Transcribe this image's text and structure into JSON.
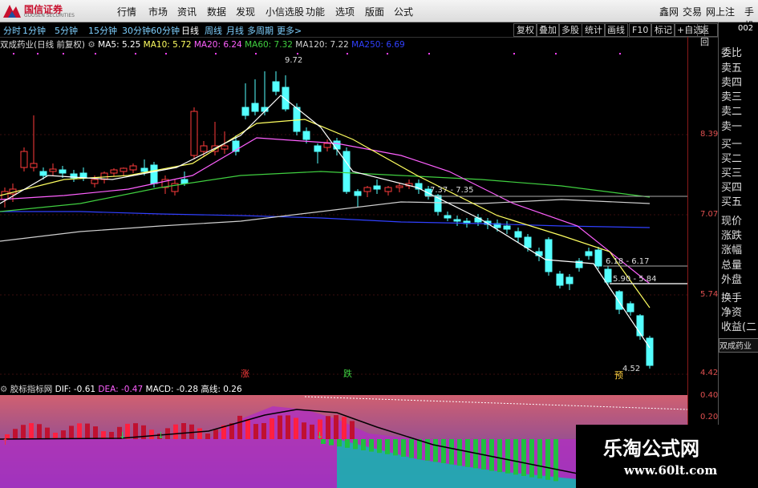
{
  "app": {
    "logo_text": "国信证券",
    "logo_sub": "GUOSEN SECURITIES"
  },
  "menu": {
    "items": [
      "行情",
      "市场",
      "资讯",
      "数据",
      "发现",
      "小信选股",
      "功能",
      "选项",
      "版面",
      "公式"
    ],
    "right_items": [
      "鑫网",
      "交易",
      "网上注",
      "手机"
    ]
  },
  "timeframes": [
    "分时",
    "1分钟",
    "5分钟",
    "15分钟",
    "30分钟",
    "60分钟",
    "日线",
    "周线",
    "月线",
    "多周期",
    "更多>"
  ],
  "active_timeframe": "日线",
  "right_buttons": [
    "复权",
    "叠加",
    "多股",
    "统计",
    "画线",
    "F10",
    "标记",
    "+自选",
    "返回"
  ],
  "ma_bar": {
    "stock": "双成药业(日线 前复权)",
    "ma5": "MA5: 5.25",
    "ma10": "MA10: 5.72",
    "ma20": "MA20: 6.24",
    "ma60": "MA60: 7.32",
    "ma120": "MA120: 7.22",
    "ma250": "MA250: 6.69"
  },
  "colors": {
    "up": "#ff3c3c",
    "down": "#54ffff",
    "ma5": "#ffffff",
    "ma10": "#ffff60",
    "ma20": "#ff60ff",
    "ma60": "#40d040",
    "ma120": "#d0d0d0",
    "ma250": "#3040ff"
  },
  "price_axis": [
    "8.39",
    "7.07",
    "5.74",
    "4.42"
  ],
  "annotations": {
    "high": "9.72",
    "low": "4.52",
    "zone1": "7.37 - 7.35",
    "zone2": "6.18 - 6.17",
    "zone3": "5.90 - 5.84",
    "marker_up": "涨",
    "marker_down": "跌",
    "marker_wave": "预"
  },
  "side_panel": {
    "top_label": "002",
    "items": [
      "委比",
      "卖五",
      "卖四",
      "卖三",
      "卖二",
      "卖一",
      "买一",
      "买二",
      "买三",
      "买四",
      "买五",
      "现价",
      "涨跌",
      "涨幅",
      "总量",
      "外盘",
      "换手",
      "净资",
      "收益(二"
    ],
    "tab": "双成药业"
  },
  "sub_indicator": {
    "name": "胶标指标网",
    "dif": "DIF: -0.61",
    "dea": "DEA: -0.47",
    "macd": "MACD: -0.28",
    "gaoxian": "高线: 0.26",
    "axis": [
      "0.40",
      "0.20"
    ]
  },
  "watermark": {
    "title": "乐淘公式网",
    "url": "www.60lt.com"
  }
}
